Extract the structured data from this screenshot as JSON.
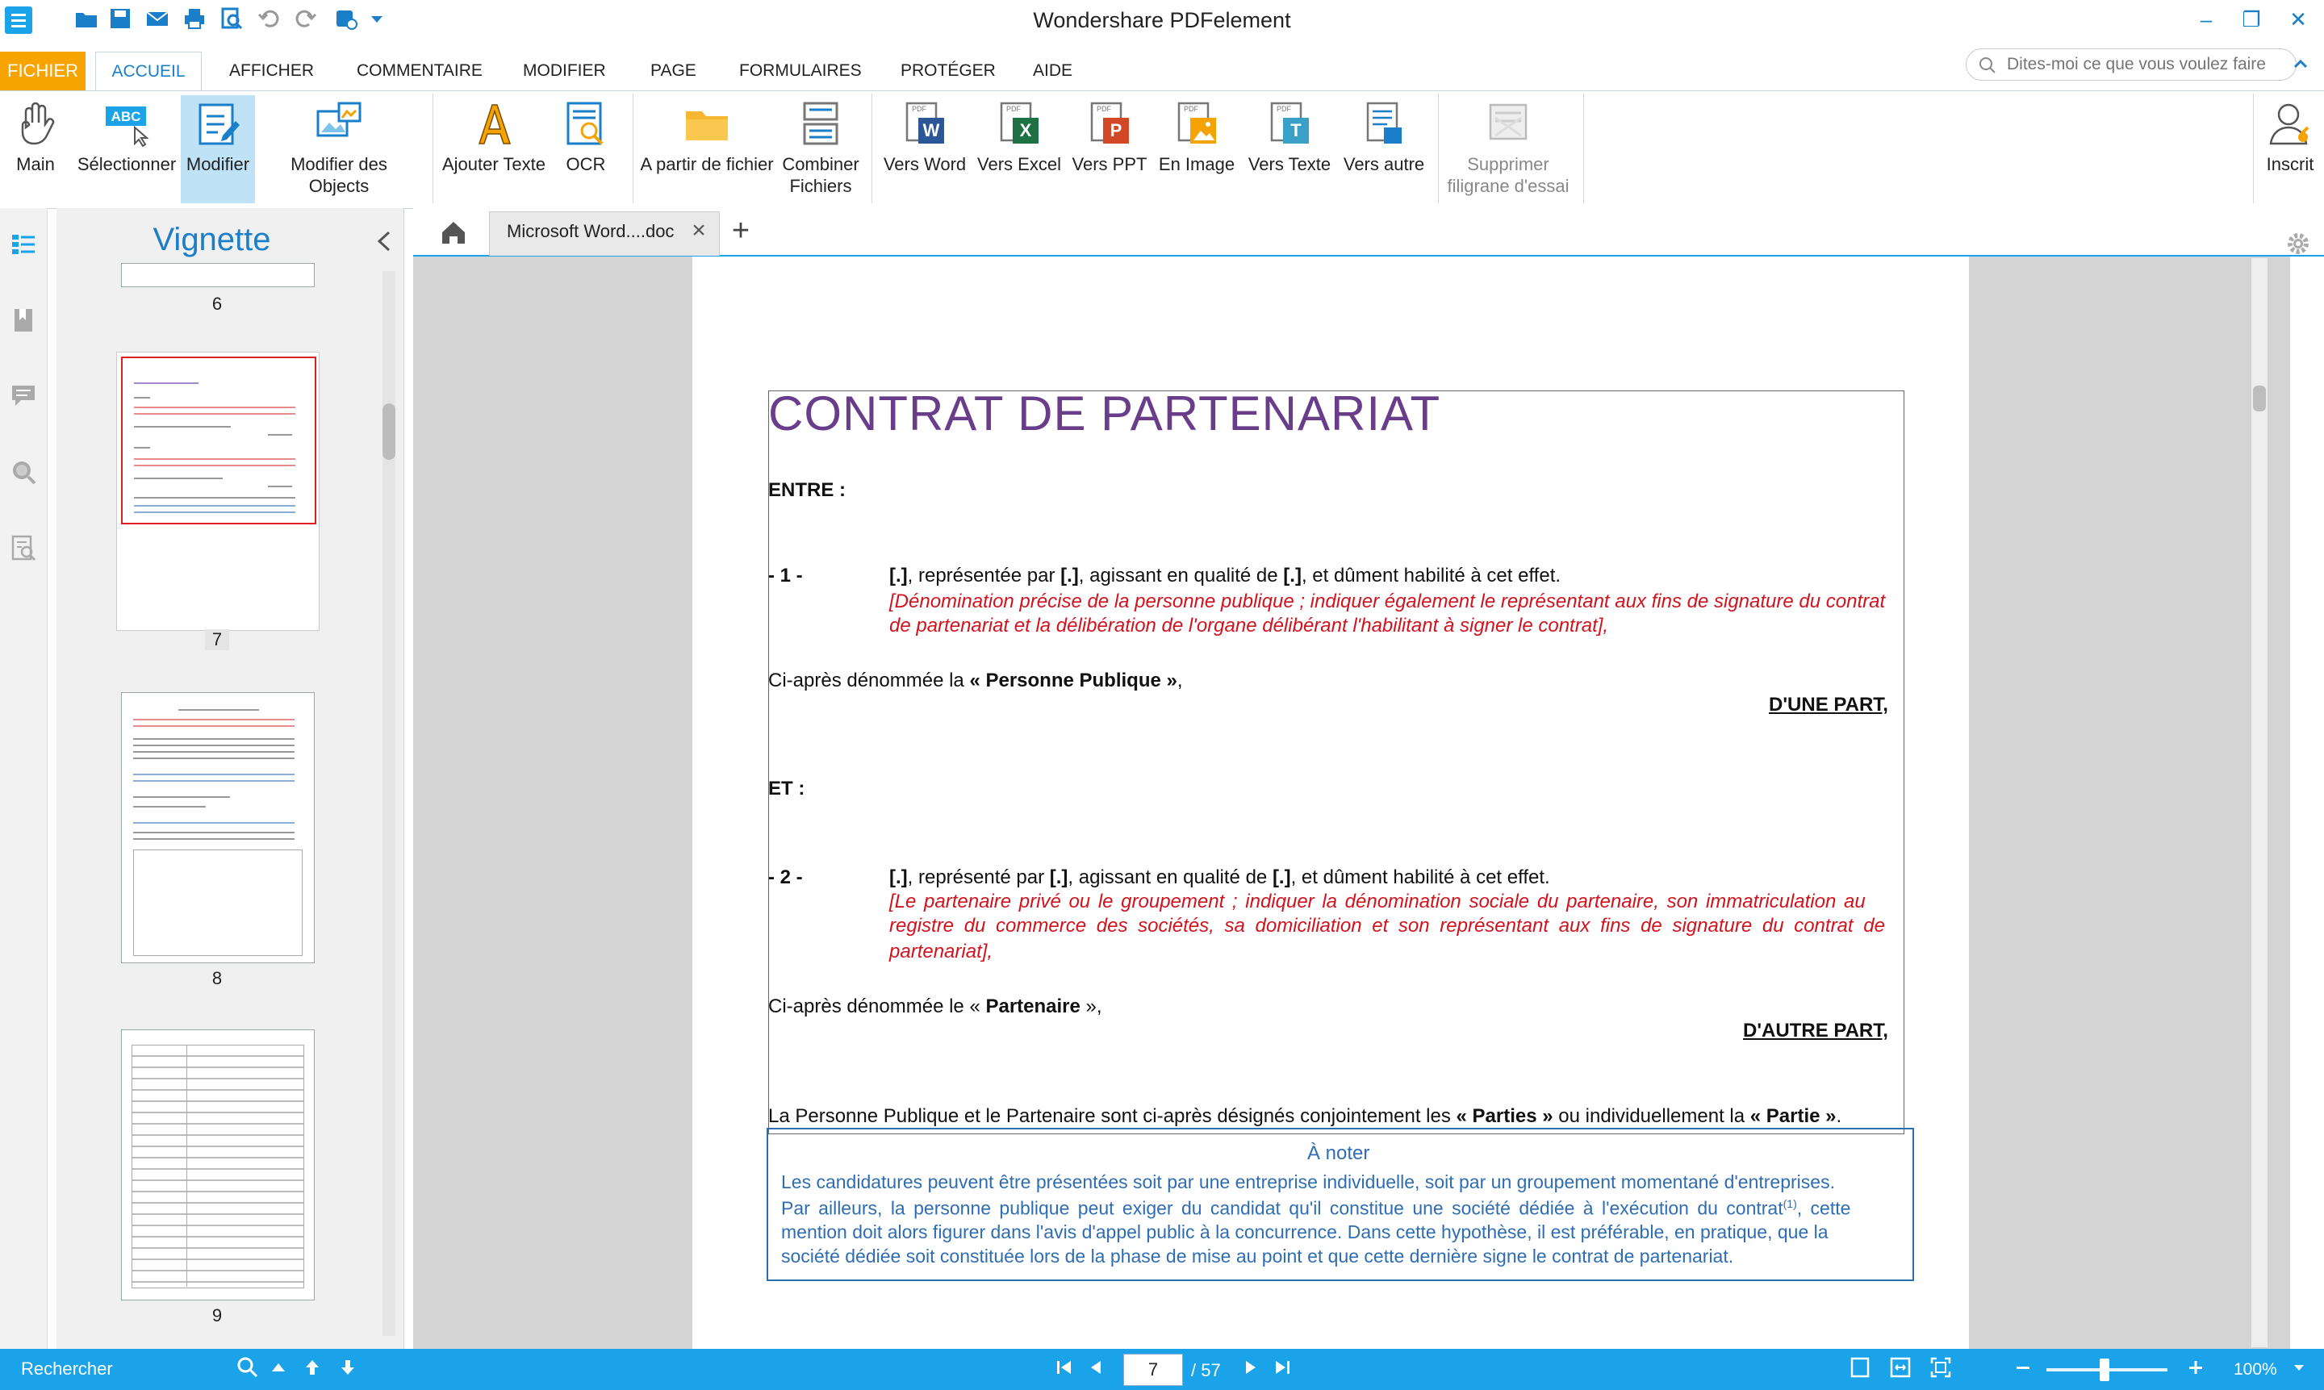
{
  "window": {
    "title": "Wondershare PDFelement"
  },
  "menu_tabs": [
    "FICHIER",
    "ACCUEIL",
    "AFFICHER",
    "COMMENTAIRE",
    "MODIFIER",
    "PAGE",
    "FORMULAIRES",
    "PROTÉGER",
    "AIDE"
  ],
  "search": {
    "placeholder": "Dites-moi ce que vous voulez faire"
  },
  "ribbon": {
    "main": "Main",
    "selectionner": "Sélectionner",
    "modifier": "Modifier",
    "modifier_objects": "Modifier des Objects",
    "ajouter_texte": "Ajouter Texte",
    "ocr": "OCR",
    "a_partir": "A partir de fichier",
    "combiner": "Combiner\nFichiers",
    "vers_word": "Vers Word",
    "vers_excel": "Vers Excel",
    "vers_ppt": "Vers PPT",
    "en_image": "En Image",
    "vers_texte": "Vers Texte",
    "vers_autre": "Vers autre",
    "supprimer": "Supprimer\nfiligrane d'essai",
    "inscrit": "Inscrit"
  },
  "thumbnails": {
    "title": "Vignette",
    "pages": [
      "6",
      "7",
      "8",
      "9"
    ]
  },
  "doc_tab": {
    "label": "Microsoft Word....doc"
  },
  "document": {
    "title": "CONTRAT DE PARTENARIAT",
    "entre": "ENTRE :",
    "p1_num": "- 1 -",
    "p1_text_a": "[.]",
    "p1_text_b": ", représentée par ",
    "p1_text_c": "[.]",
    "p1_text_d": ", agissant en qualité de ",
    "p1_text_e": "[.]",
    "p1_text_f": ", et dûment habilité à cet effet.",
    "p1_red_1": "[Dénomination précise de la personne publique ; indiquer également le représentant aux fins de signature du contrat",
    "p1_red_2": "de partenariat et la délibération de l'organe délibérant l'habilitant à signer le contrat],",
    "ci_pp_a": "Ci-après dénommée la ",
    "ci_pp_b": "« Personne Publique »",
    "ci_pp_c": ",",
    "dune_part": "D'UNE PART,",
    "et": "ET :",
    "p2_num": "- 2 -",
    "p2_text_a": "[.]",
    "p2_text_b": ", représenté par ",
    "p2_text_c": "[.]",
    "p2_text_d": ", agissant en qualité de ",
    "p2_text_e": "[.]",
    "p2_text_f": ", et dûment habilité à cet effet.",
    "p2_red_1": "[Le partenaire privé ou le groupement ; indiquer la dénomination sociale du partenaire, son immatriculation au",
    "p2_red_2": "registre du commerce des sociétés, sa domiciliation et son représentant aux fins de signature du contrat de",
    "p2_red_3": "partenariat],",
    "ci_pa_a": "Ci-après dénommée le « ",
    "ci_pa_b": "Partenaire",
    "ci_pa_c": " »,",
    "dautre_part": "D'AUTRE PART,",
    "parties_a": "La Personne Publique et le Partenaire sont ci-après désignés conjointement les ",
    "parties_b": "« Parties »",
    "parties_c": " ou individuellement la ",
    "parties_d": "« Partie »",
    "parties_e": ".",
    "note_title": "À noter",
    "note_1": "Les candidatures peuvent être présentées soit par une entreprise individuelle, soit par un groupement momentané d'entreprises.",
    "note_2": "Par ailleurs, la personne publique peut exiger du candidat qu'il constitue une société dédiée à l'exécution du contrat",
    "note_2_sup": "(1)",
    "note_2_end": ", cette",
    "note_3": "mention doit alors figurer dans l'avis d'appel public à la concurrence. Dans cette hypothèse, il est préférable, en pratique, que la",
    "note_4": "société dédiée soit constituée lors de la phase de mise au point et que cette dernière signe le contrat de partenariat."
  },
  "status": {
    "search_label": "Rechercher",
    "current_page": "7",
    "total_pages": "/ 57",
    "zoom": "100%",
    "zoom_fraction": 0.48
  },
  "colors": {
    "accent": "#1aa3e8",
    "fichier": "#f7a400",
    "title_purple": "#6a3d8a",
    "red_text": "#d1131d",
    "note_blue": "#2f6db3"
  }
}
